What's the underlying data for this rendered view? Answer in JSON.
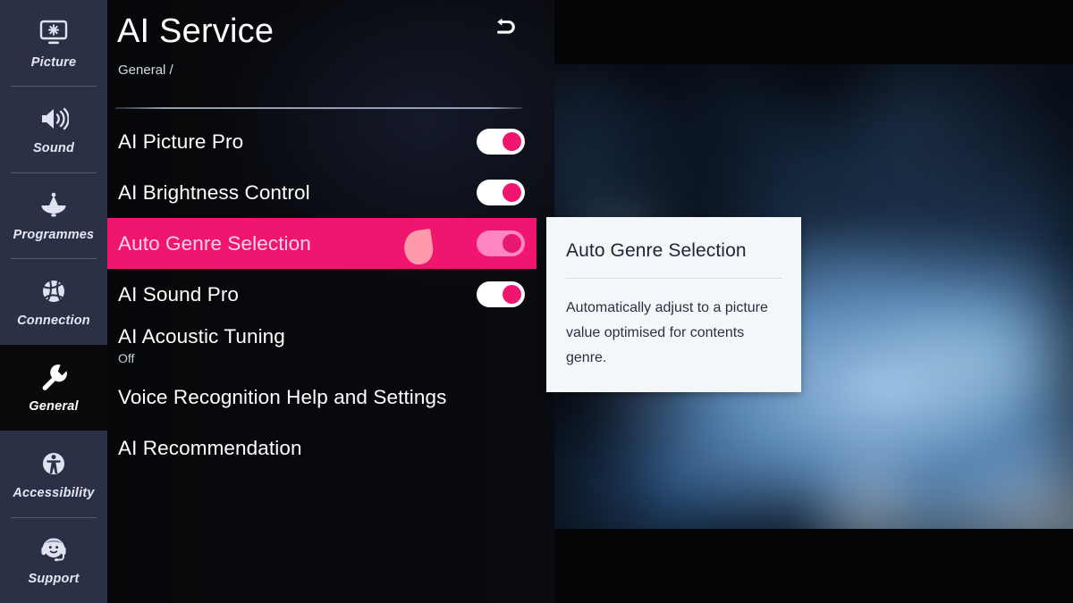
{
  "sidebar": {
    "items": [
      {
        "label": "Picture",
        "icon": "picture-icon",
        "active": false
      },
      {
        "label": "Sound",
        "icon": "sound-icon",
        "active": false
      },
      {
        "label": "Programmes",
        "icon": "programmes-icon",
        "active": false
      },
      {
        "label": "Connection",
        "icon": "connection-icon",
        "active": false
      },
      {
        "label": "General",
        "icon": "general-wrench-icon",
        "active": true
      },
      {
        "label": "Accessibility",
        "icon": "accessibility-icon",
        "active": false
      },
      {
        "label": "Support",
        "icon": "support-headset-icon",
        "active": false
      }
    ]
  },
  "header": {
    "title": "AI Service",
    "breadcrumb": "General /",
    "back_icon": "back-arrow-icon"
  },
  "settings": {
    "rows": [
      {
        "label": "AI Picture Pro",
        "sub": "",
        "control": "toggle",
        "state": "on",
        "selected": false
      },
      {
        "label": "AI Brightness Control",
        "sub": "",
        "control": "toggle",
        "state": "on",
        "selected": false
      },
      {
        "label": "Auto Genre Selection",
        "sub": "",
        "control": "toggle",
        "state": "on",
        "selected": true
      },
      {
        "label": "AI Sound Pro",
        "sub": "",
        "control": "toggle",
        "state": "on",
        "selected": false
      },
      {
        "label": "AI Acoustic Tuning",
        "sub": "Off",
        "control": "none",
        "state": "",
        "selected": false
      },
      {
        "label": "Voice Recognition Help and Settings",
        "sub": "",
        "control": "none",
        "state": "",
        "selected": false
      },
      {
        "label": "AI Recommendation",
        "sub": "",
        "control": "none",
        "state": "",
        "selected": false
      }
    ]
  },
  "tooltip": {
    "title": "Auto Genre Selection",
    "body": "Automatically adjust to a picture value optimised for contents genre."
  },
  "colors": {
    "sidebar_bg": "#2b3047",
    "panel_bg": "#07080b",
    "highlight_pink": "#f0156f",
    "toggle_on": "#f0156f",
    "tooltip_bg": "#f4f7fa",
    "cursor": "#ff9aab"
  }
}
